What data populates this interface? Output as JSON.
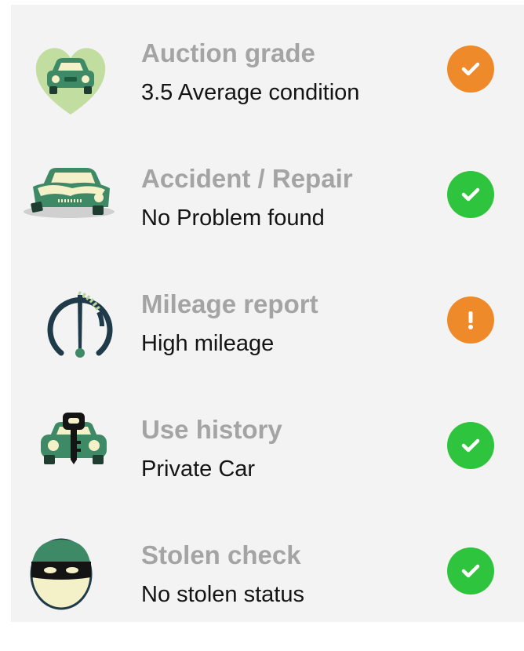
{
  "colors": {
    "ok": "#2ec43e",
    "warning": "#ef8a2a",
    "title": "#a4a4a4",
    "value": "#141414",
    "panel": "#f3f3f3",
    "icon_green": "#3f8a66",
    "icon_cream": "#f4f0c8"
  },
  "items": [
    {
      "title": "Auction grade",
      "value": "3.5 Average condition",
      "icon": "heart-car-icon",
      "status": "check",
      "status_color": "warning"
    },
    {
      "title": "Accident / Repair",
      "value": "No Problem found",
      "icon": "damaged-car-icon",
      "status": "check",
      "status_color": "ok"
    },
    {
      "title": "Mileage report",
      "value": "High mileage",
      "icon": "speedometer-icon",
      "status": "exclamation",
      "status_color": "warning"
    },
    {
      "title": "Use history",
      "value": "Private Car",
      "icon": "car-key-icon",
      "status": "check",
      "status_color": "ok"
    },
    {
      "title": "Stolen check",
      "value": "No stolen status",
      "icon": "thief-mask-icon",
      "status": "check",
      "status_color": "ok"
    }
  ]
}
